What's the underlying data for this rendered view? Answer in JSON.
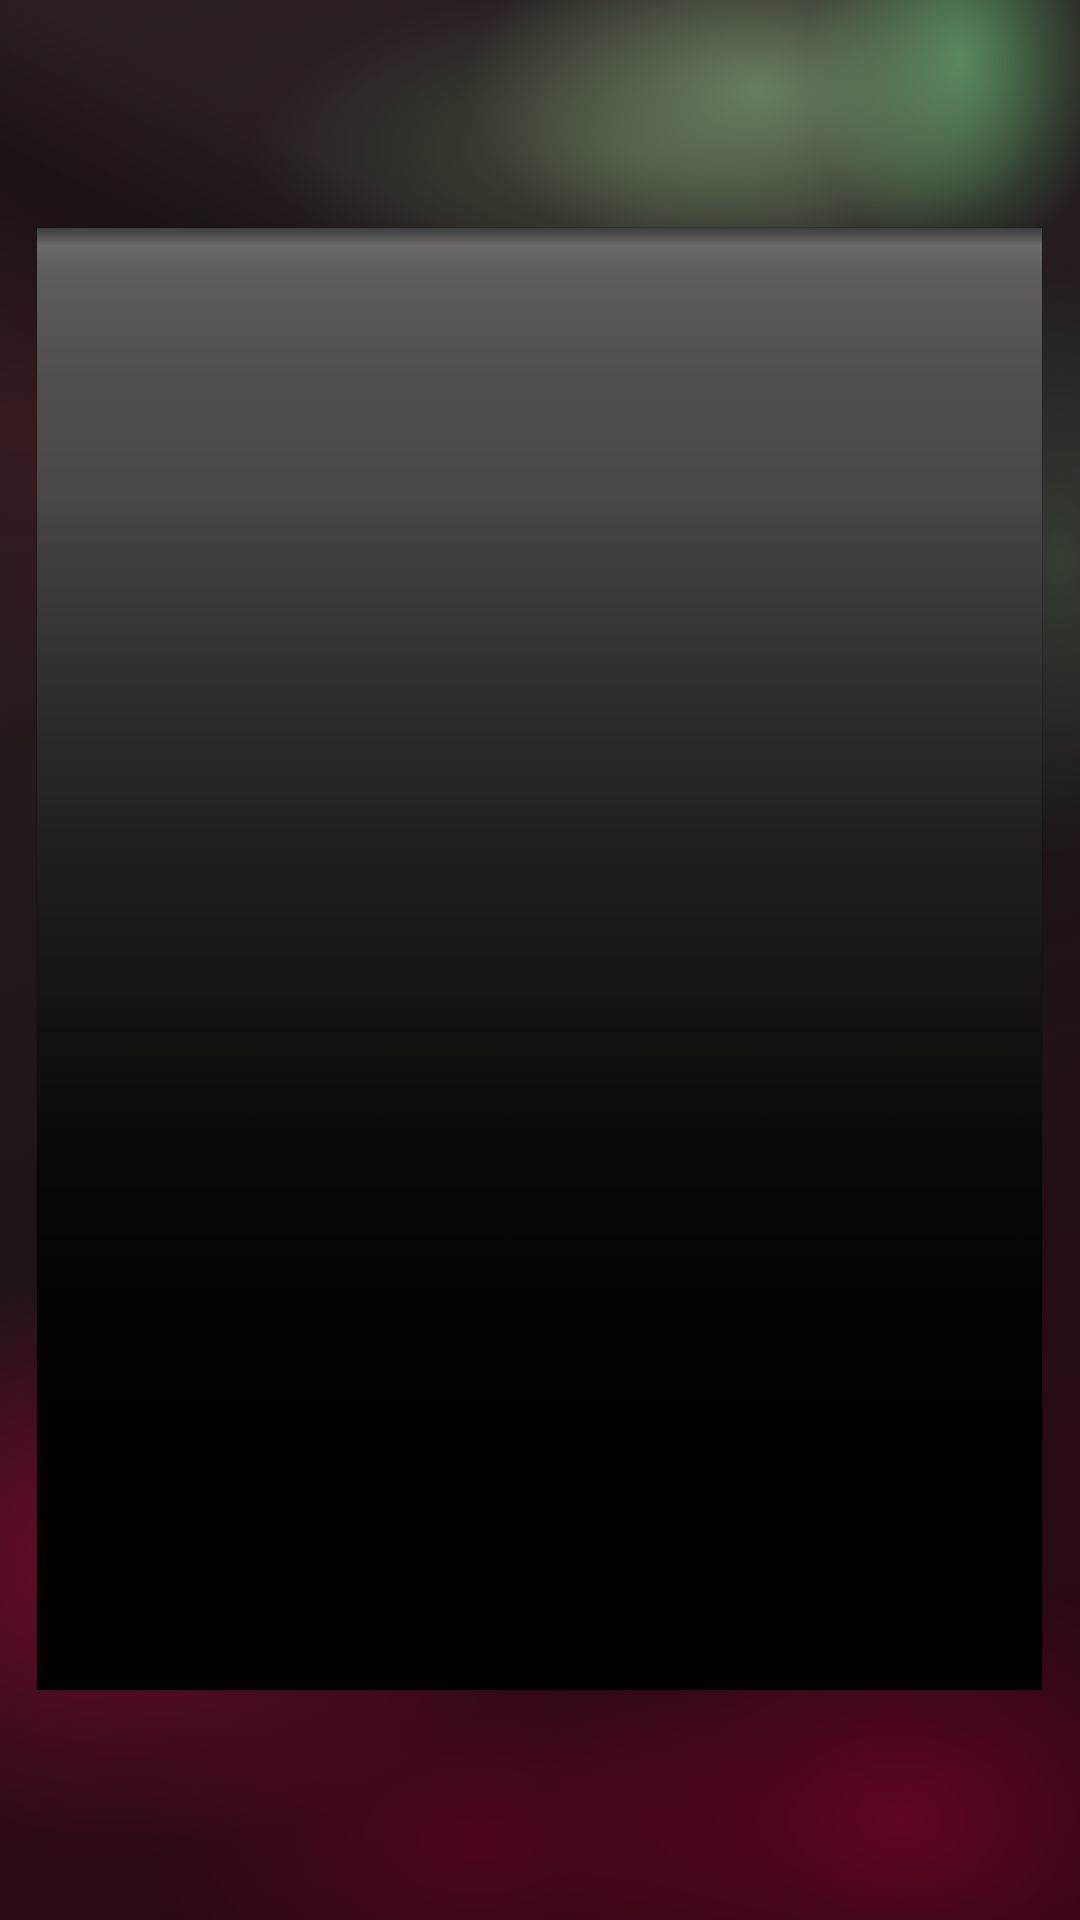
{
  "screen": {
    "background_description_colors": {
      "top_right_foliage": "#5f8a60",
      "bottom_magenta": "#7a0a2c",
      "base_dark": "#1c1416"
    }
  },
  "content_panel": {
    "gradient_top_color": "#6b6a69",
    "gradient_bottom_color": "#000000"
  }
}
